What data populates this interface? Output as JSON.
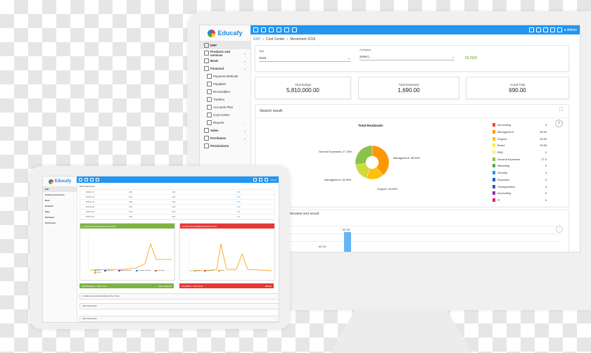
{
  "desktop": {
    "brand": "Educafy",
    "sidebar": {
      "items": [
        {
          "label": "ERP",
          "type": "top"
        },
        {
          "label": "Products and services",
          "type": "top",
          "chevron": true
        },
        {
          "label": "Book",
          "type": "top",
          "chevron": true
        },
        {
          "label": "Financial",
          "type": "top",
          "chevron": true
        },
        {
          "label": "Payment Methods",
          "type": "sub"
        },
        {
          "label": "Payables",
          "type": "sub"
        },
        {
          "label": "Receivables",
          "type": "sub"
        },
        {
          "label": "Tranfers",
          "type": "sub"
        },
        {
          "label": "Accounts Plan",
          "type": "sub"
        },
        {
          "label": "Cost Center",
          "type": "sub"
        },
        {
          "label": "Reports",
          "type": "sub",
          "chevron": true
        },
        {
          "label": "Sales",
          "type": "top",
          "chevron": true
        },
        {
          "label": "Purchases",
          "type": "top",
          "chevron": true
        },
        {
          "label": "Permissions",
          "type": "top"
        }
      ]
    },
    "topbar": {
      "user": "Admin"
    },
    "breadcrumb": {
      "root": "ERP",
      "parent": "Cost Center",
      "current": "Movement 2019"
    },
    "filters": {
      "year_label": "Year",
      "year_value": "2019",
      "company_label": "Company",
      "company_placeholder": "Select...",
      "filter_button": "FILTER"
    },
    "cards": [
      {
        "label": "Total Budget",
        "value": "5,810,000.00"
      },
      {
        "label": "Total Estimated",
        "value": "1,690.00"
      },
      {
        "label": "Actual Total",
        "value": "690.00"
      }
    ],
    "result": {
      "header": "Search result:",
      "chart_title": "Total Realizado:",
      "pie_labels": {
        "general": "General Expenses: 27.35%",
        "management": "Management: 16.96%",
        "support": "Support: 16.90%",
        "mgmt_right": "Management: 38.99%"
      },
      "lower_title": "s estimated and actual:",
      "bar_label_top": "617.00",
      "bar_label_low": "617.00"
    },
    "chart_data": {
      "type": "pie",
      "title": "Total Realizado:",
      "slices": [
        {
          "name": "Management",
          "value": 38.99,
          "color": "#ff9800"
        },
        {
          "name": "Support",
          "value": 16.9,
          "color": "#ffc107"
        },
        {
          "name": "Management",
          "value": 16.96,
          "color": "#cddc39"
        },
        {
          "name": "General Expenses",
          "value": 27.35,
          "color": "#8bc34a"
        }
      ],
      "legend": [
        {
          "name": "Accounting",
          "value": "0",
          "color": "#f44336"
        },
        {
          "name": "Management",
          "value": "38.99",
          "color": "#ff9800"
        },
        {
          "name": "Support",
          "value": "16.96",
          "color": "#ffc107"
        },
        {
          "name": "Board",
          "value": "16.96",
          "color": "#ffeb3b"
        },
        {
          "name": "R&D",
          "value": "0",
          "color": "#fff176"
        },
        {
          "name": "General Expenses",
          "value": "27.3",
          "color": "#8bc34a"
        },
        {
          "name": "Marketing",
          "value": "0",
          "color": "#4caf50"
        },
        {
          "name": "Security",
          "value": "0",
          "color": "#2196f3"
        },
        {
          "name": "Expenses",
          "value": "0",
          "color": "#1565c0"
        },
        {
          "name": "Transportation",
          "value": "0",
          "color": "#3f51b5"
        },
        {
          "name": "Accounting",
          "value": "0",
          "color": "#9c27b0"
        },
        {
          "name": "IT",
          "value": "0",
          "color": "#e91e63"
        }
      ]
    }
  },
  "tablet": {
    "brand": "Educafy",
    "sidebar": [
      {
        "label": "ERP"
      },
      {
        "label": "Products and services"
      },
      {
        "label": "Book"
      },
      {
        "label": "Financial"
      },
      {
        "label": "Sales"
      },
      {
        "label": "Purchases"
      },
      {
        "label": "Permissions"
      }
    ],
    "user": "Admin",
    "breadcrumb": "ERP  Dashboard",
    "rows": [
      [
        "2019-11-17",
        "0.00",
        "0.00",
        "0.00"
      ],
      [
        "2019-11-18",
        "0.00",
        "0.00",
        "0.00"
      ],
      [
        "2019-11-19",
        "0.00",
        "0.00",
        "0.00"
      ],
      [
        "2019-11-20",
        "0.00",
        "0.00",
        "0.00"
      ],
      [
        "2019-11-21",
        "0.00",
        "0.00",
        "0.00"
      ],
      [
        "2019-11-22",
        "0.00",
        "0.00",
        "0.00"
      ]
    ],
    "panel_left": {
      "title": "12 MONTHS REVENUE EVOLUTION",
      "color": "#7cb342"
    },
    "panel_right": {
      "title": "12 MONTHS EXPENSES EVOLUTION",
      "color": "#e53935"
    },
    "receivables": {
      "title": "RECEIVABLES - PAST DUE",
      "value": "Value: R$97.00"
    },
    "payables": {
      "title": "PAYABLES - PAST DUE",
      "value": "R$0.00"
    },
    "accordions": [
      "PAYABLES AND RECEIVABLES DUE TODAY",
      "NEW RELEASES",
      "NEW RELEASES"
    ],
    "legend_left": [
      "Paid",
      "Expected",
      "Mailbox Interest",
      "Overdue Opening",
      "Canceled",
      "Open"
    ],
    "legend_right": [
      "Paid",
      "Canceled",
      "Open"
    ]
  }
}
